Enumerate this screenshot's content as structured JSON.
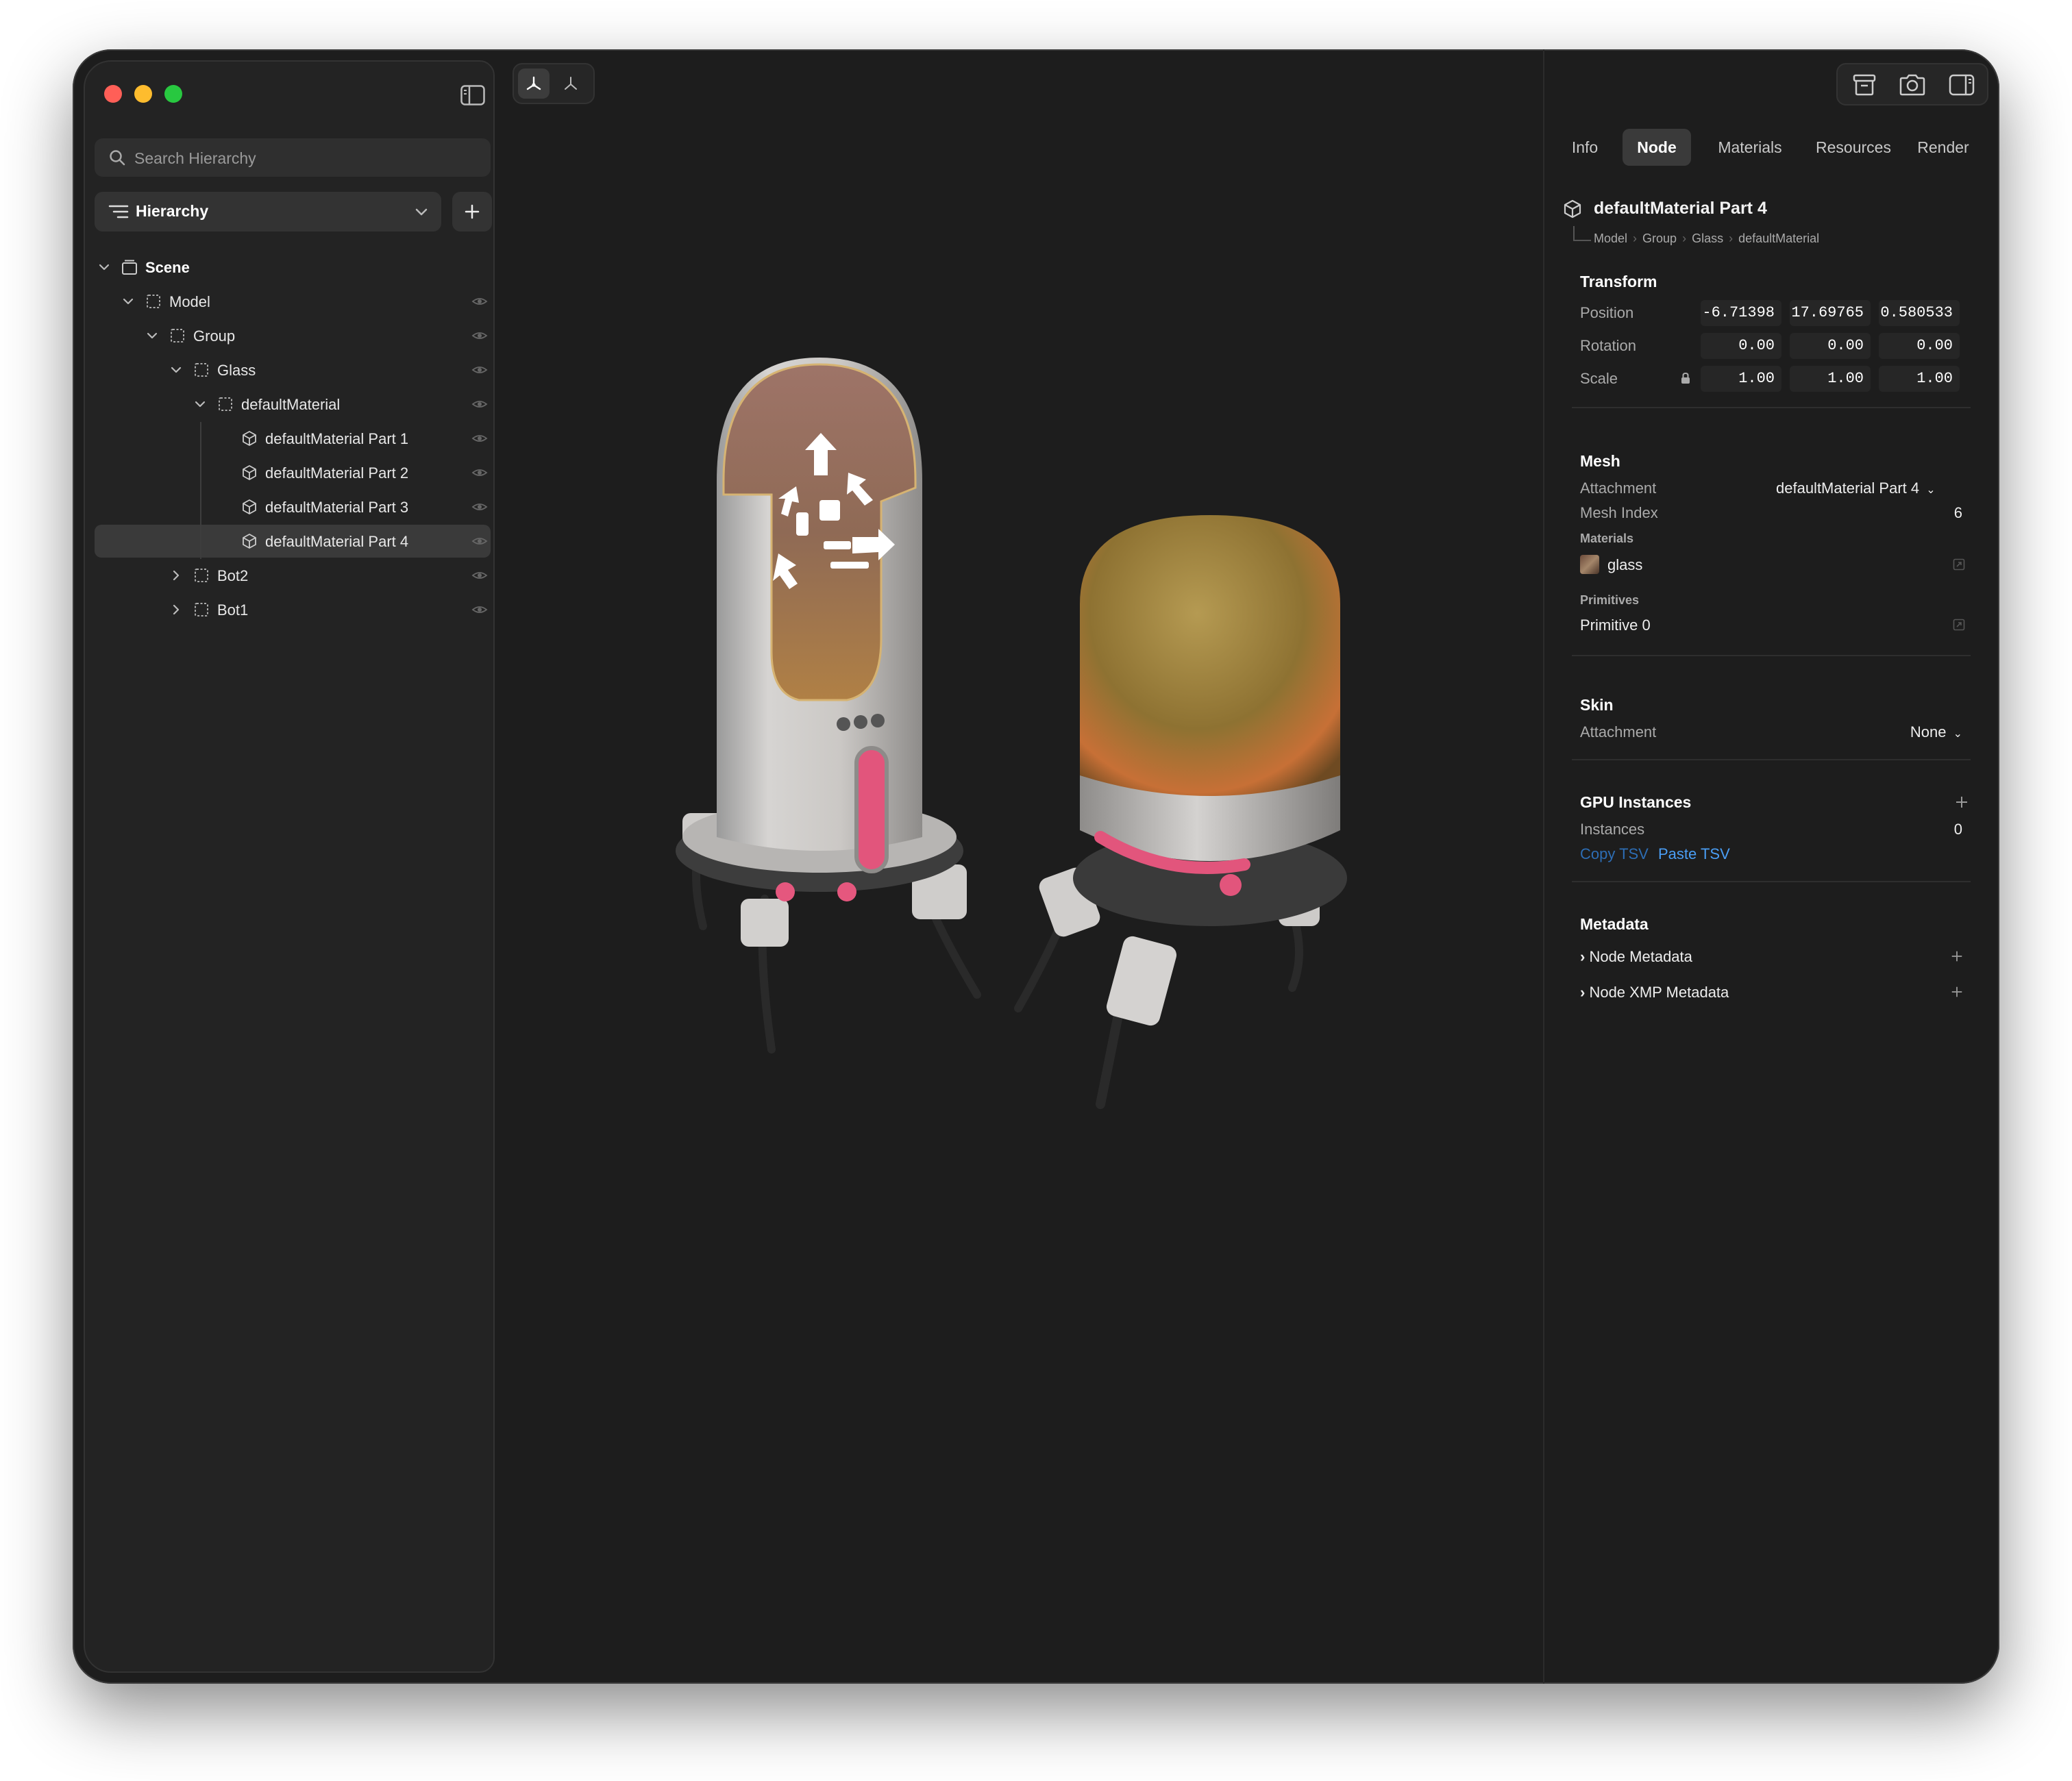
{
  "search": {
    "placeholder": "Search Hierarchy"
  },
  "hierarchy_select": {
    "label": "Hierarchy"
  },
  "tree": [
    {
      "label": "Scene",
      "bold": true
    },
    {
      "label": "Model"
    },
    {
      "label": "Group"
    },
    {
      "label": "Glass"
    },
    {
      "label": "defaultMaterial"
    },
    {
      "label": "defaultMaterial Part 1"
    },
    {
      "label": "defaultMaterial Part 2"
    },
    {
      "label": "defaultMaterial Part 3"
    },
    {
      "label": "defaultMaterial Part 4",
      "selected": true
    },
    {
      "label": "Bot2"
    },
    {
      "label": "Bot1"
    }
  ],
  "tabs": [
    "Info",
    "Node",
    "Materials",
    "Resources",
    "Render"
  ],
  "active_tab": "Node",
  "inspector": {
    "title": "defaultMaterial Part 4",
    "breadcrumb": [
      "Model",
      "Group",
      "Glass",
      "defaultMaterial"
    ],
    "transform": {
      "title": "Transform",
      "position_label": "Position",
      "rotation_label": "Rotation",
      "scale_label": "Scale",
      "position": [
        "-6.71398",
        "17.69765",
        "0.580533"
      ],
      "rotation": [
        "0.00",
        "0.00",
        "0.00"
      ],
      "scale": [
        "1.00",
        "1.00",
        "1.00"
      ]
    },
    "mesh": {
      "title": "Mesh",
      "attachment_label": "Attachment",
      "attachment_value": "defaultMaterial Part 4",
      "mesh_index_label": "Mesh Index",
      "mesh_index_value": "6",
      "materials_label": "Materials",
      "material_name": "glass",
      "primitives_label": "Primitives",
      "primitive_name": "Primitive 0"
    },
    "skin": {
      "title": "Skin",
      "attachment_label": "Attachment",
      "attachment_value": "None"
    },
    "gpu": {
      "title": "GPU Instances",
      "instances_label": "Instances",
      "instances_value": "0",
      "copy_label": "Copy TSV",
      "paste_label": "Paste TSV"
    },
    "metadata": {
      "title": "Metadata",
      "node_metadata": "Node Metadata",
      "node_xmp_metadata": "Node XMP Metadata"
    }
  },
  "colors": {
    "accent": "#4a9ef5",
    "window_bg": "#1d1d1d",
    "sidebar_bg": "#232323",
    "selected_row": "#3a3a3a"
  }
}
